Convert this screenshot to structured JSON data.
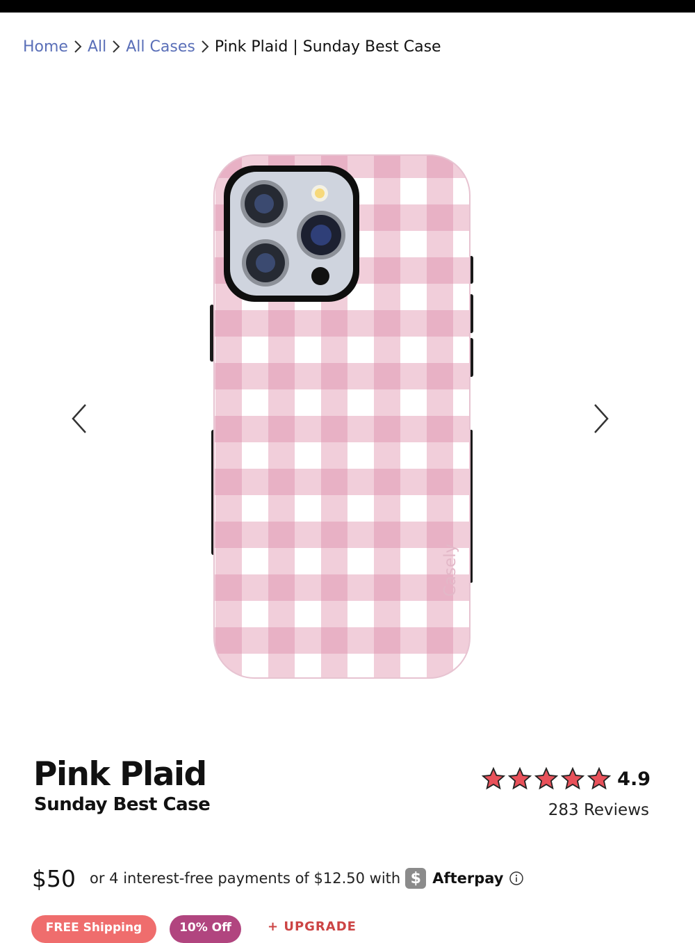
{
  "breadcrumb": {
    "items": [
      "Home",
      "All",
      "All Cases"
    ],
    "current": "Pink Plaid | Sunday Best Case"
  },
  "product": {
    "title": "Pink Plaid",
    "subtitle": "Sunday Best Case",
    "case_brand_mark": "Casely",
    "rating_value": "4.9",
    "rating_stars": 5,
    "reviews": "283 Reviews",
    "price": "$50",
    "installment_text": "or 4 interest-free payments of $12.50 with",
    "afterpay_symbol": "$",
    "afterpay_label": "Afterpay"
  },
  "promos": {
    "shipping": "FREE Shipping",
    "discount": "10% Off",
    "upgrade": "+ UPGRADE"
  },
  "colors": {
    "link": "#5a6fb8",
    "star": "#e8515a",
    "plaid_light": "#f5dbe5",
    "plaid_dark": "#e6a9c0",
    "shipping_pill": "#ef6d6d",
    "discount_pill": "#b1457f"
  },
  "icons": {
    "breadcrumb_separator": "chevron-right-icon",
    "prev": "chevron-left-icon",
    "next": "chevron-right-icon",
    "star": "star-icon",
    "info": "info-icon"
  }
}
